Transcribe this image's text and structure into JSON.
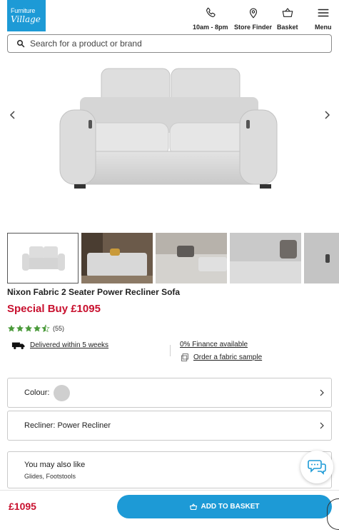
{
  "header": {
    "logo_line1": "Furniture",
    "logo_line2": "Village",
    "hours_label": "10am - 8pm",
    "store_label": "Store Finder",
    "basket_label": "Basket",
    "menu_label": "Menu"
  },
  "search": {
    "placeholder": "Search for a product or brand"
  },
  "gallery": {
    "thumbnail_count": 5,
    "active_index": 0
  },
  "product": {
    "title": "Nixon Fabric 2 Seater Power Recliner Sofa",
    "price_label": "Special Buy £1095",
    "rating_value": 4.5,
    "review_count": "(55)"
  },
  "services": {
    "delivery": "Delivered within 5 weeks",
    "finance": "0% Finance available",
    "sample": "Order a fabric sample"
  },
  "options": {
    "colour_label": "Colour:",
    "colour_swatch": "#cfcfcf",
    "recliner_label": "Recliner: Power Recliner"
  },
  "also_like": {
    "title": "You may also like",
    "subtitle": "Glides, Footstools"
  },
  "bottom_bar": {
    "price": "£1095",
    "add_button": "ADD TO BASKET"
  },
  "colors": {
    "brand_blue": "#1d9ad6",
    "price_red": "#c8102e"
  }
}
